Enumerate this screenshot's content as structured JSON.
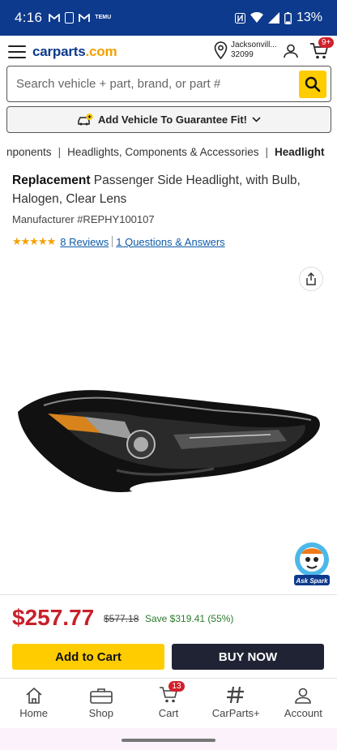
{
  "status_bar": {
    "time": "4:16",
    "battery": "13%",
    "icons": [
      "gmail-icon",
      "phone-icon",
      "gmail-icon",
      "temu-icon",
      "nfc-icon",
      "wifi-icon",
      "signal-icon",
      "battery-icon"
    ],
    "temu_label": "TEMU"
  },
  "header": {
    "logo_main": "carparts",
    "logo_suffix": ".com",
    "location_city": "Jacksonvill...",
    "location_zip": "32099",
    "cart_badge": "9+"
  },
  "search": {
    "placeholder": "Search vehicle + part, brand, or part #"
  },
  "vehicle_bar": {
    "label": "Add Vehicle To Guarantee Fit!"
  },
  "breadcrumb": {
    "items": [
      "nponents",
      "Headlights, Components & Accessories",
      "Headlight"
    ],
    "separator": "|"
  },
  "product": {
    "title_bold": "Replacement",
    "title_rest": " Passenger Side Headlight, with Bulb, Halogen, Clear Lens",
    "manufacturer": "Manufacturer #REPHY100107",
    "rating": 4.5,
    "stars": "★★★★★",
    "reviews_label": "8 Reviews",
    "qa_label": "1 Questions & Answers"
  },
  "assistant": {
    "label": "Ask Spark"
  },
  "pricing": {
    "price": "$257.77",
    "was_price": "$577.18",
    "savings": "Save $319.41 (55%)",
    "add_to_cart": "Add to Cart",
    "buy_now": "BUY NOW"
  },
  "bottom_nav": {
    "items": [
      {
        "label": "Home",
        "icon": "home-icon"
      },
      {
        "label": "Shop",
        "icon": "toolbox-icon"
      },
      {
        "label": "Cart",
        "icon": "cart-icon",
        "badge": "13"
      },
      {
        "label": "CarParts+",
        "icon": "carparts-plus-icon"
      },
      {
        "label": "Account",
        "icon": "account-icon"
      }
    ]
  },
  "colors": {
    "brand_blue": "#0d3a8c",
    "accent_yellow": "#ffcc00",
    "price_red": "#c8202a",
    "save_green": "#2d7a2d",
    "buy_dark": "#1f2333"
  }
}
